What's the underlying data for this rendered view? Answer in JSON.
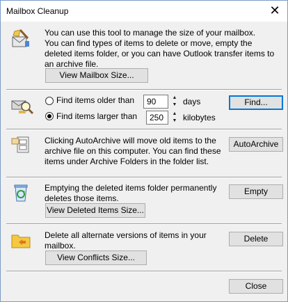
{
  "window": {
    "title": "Mailbox Cleanup",
    "close_glyph": "✕"
  },
  "section_size": {
    "line1": "You can use this tool to manage the size of your mailbox.",
    "line2": "You can find types of items to delete or move, empty the deleted items folder, or you can have Outlook transfer items to an archive file.",
    "button": "View Mailbox Size..."
  },
  "section_find": {
    "option_older": {
      "label": "Find items older than",
      "value": "90",
      "unit": "days",
      "selected": false
    },
    "option_larger": {
      "label": "Find items larger than",
      "value": "250",
      "unit": "kilobytes",
      "selected": true
    },
    "button": "Find..."
  },
  "section_archive": {
    "text": "Clicking AutoArchive will move old items to the archive file on this computer. You can find these items under Archive Folders in the folder list.",
    "button": "AutoArchive"
  },
  "section_deleted": {
    "text": "Emptying the deleted items folder permanently deletes those items.",
    "button_empty": "Empty",
    "button_view": "View Deleted Items Size..."
  },
  "section_conflicts": {
    "text": "Delete all alternate versions of items in your mailbox.",
    "button_delete": "Delete",
    "button_view": "View Conflicts Size..."
  },
  "footer": {
    "close": "Close"
  },
  "icons": {
    "cleanup": "broom-mailbox-icon",
    "find": "magnifier-envelope-icon",
    "archive": "file-cabinet-icon",
    "recycle": "recycle-bin-icon",
    "conflicts": "folder-arrows-icon"
  }
}
